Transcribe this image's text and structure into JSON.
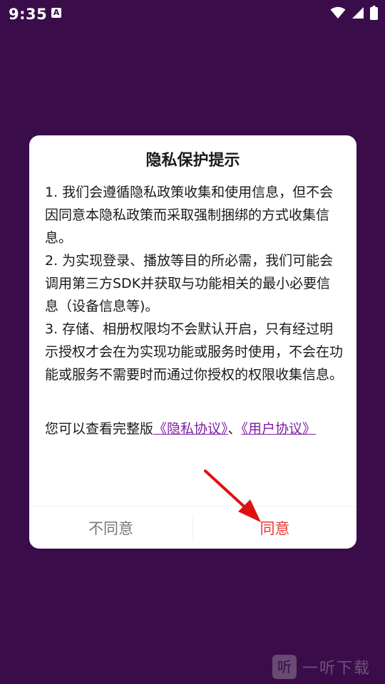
{
  "status_bar": {
    "time": "9:35",
    "a_icon": "A"
  },
  "dialog": {
    "title": "隐私保护提示",
    "paragraphs": [
      "1. 我们会遵循隐私政策收集和使用信息，但不会因同意本隐私政策而采取强制捆绑的方式收集信息。",
      "2. 为实现登录、播放等目的所必需，我们可能会调用第三方SDK并获取与功能相关的最小必要信息（设备信息等)。",
      "3. 存储、相册权限均不会默认开启，只有经过明示授权才会在为实现功能或服务时使用，不会在功能或服务不需要时而通过你授权的权限收集信息。"
    ],
    "links_prefix": "您可以查看完整版",
    "privacy_link": "《隐私协议》",
    "separator": "、",
    "user_link": "《用户协议》",
    "disagree_label": "不同意",
    "agree_label": "同意"
  },
  "watermark": {
    "logo_char": "听",
    "text": "一听下载"
  },
  "colors": {
    "background": "#3a0d4a",
    "link": "#7b1fa2",
    "agree": "#e53935",
    "disagree": "#777777",
    "arrow": "#e01010"
  },
  "icons": {
    "wifi": "wifi-icon",
    "signal": "signal-icon",
    "battery": "battery-icon",
    "a_notification": "a-notification-icon"
  }
}
